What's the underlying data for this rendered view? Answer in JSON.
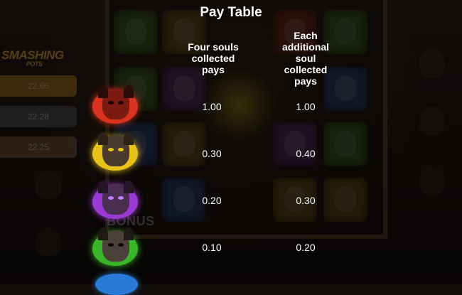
{
  "pay_table": {
    "title": "Pay Table",
    "col_four_header": "Four souls\ncollected\npays",
    "col_each_header": "Each\nadditional\nsoul\ncollected\npays",
    "rows": [
      {
        "name": "red",
        "four": "1.00",
        "each": "1.00",
        "ring": "#d8331e",
        "face": "#7a1a10",
        "horn": "#2a0c08"
      },
      {
        "name": "yellow",
        "four": "0.30",
        "each": "0.40",
        "ring": "#e6c21a",
        "face": "#4a3a2e",
        "horn": "#2c2218"
      },
      {
        "name": "purple",
        "four": "0.20",
        "each": "0.30",
        "ring": "#9a3ad2",
        "face": "#4a2e52",
        "horn": "#241426"
      },
      {
        "name": "green",
        "four": "0.10",
        "each": "0.20",
        "ring": "#3ab52a",
        "face": "#4a4238",
        "horn": "#1e1a14"
      }
    ]
  },
  "background": {
    "logo_text": "SMASHING",
    "logo_sub": "POTS",
    "wins": [
      "22.66",
      "22.28",
      "22.25"
    ],
    "bonus_text": "BONUS"
  }
}
